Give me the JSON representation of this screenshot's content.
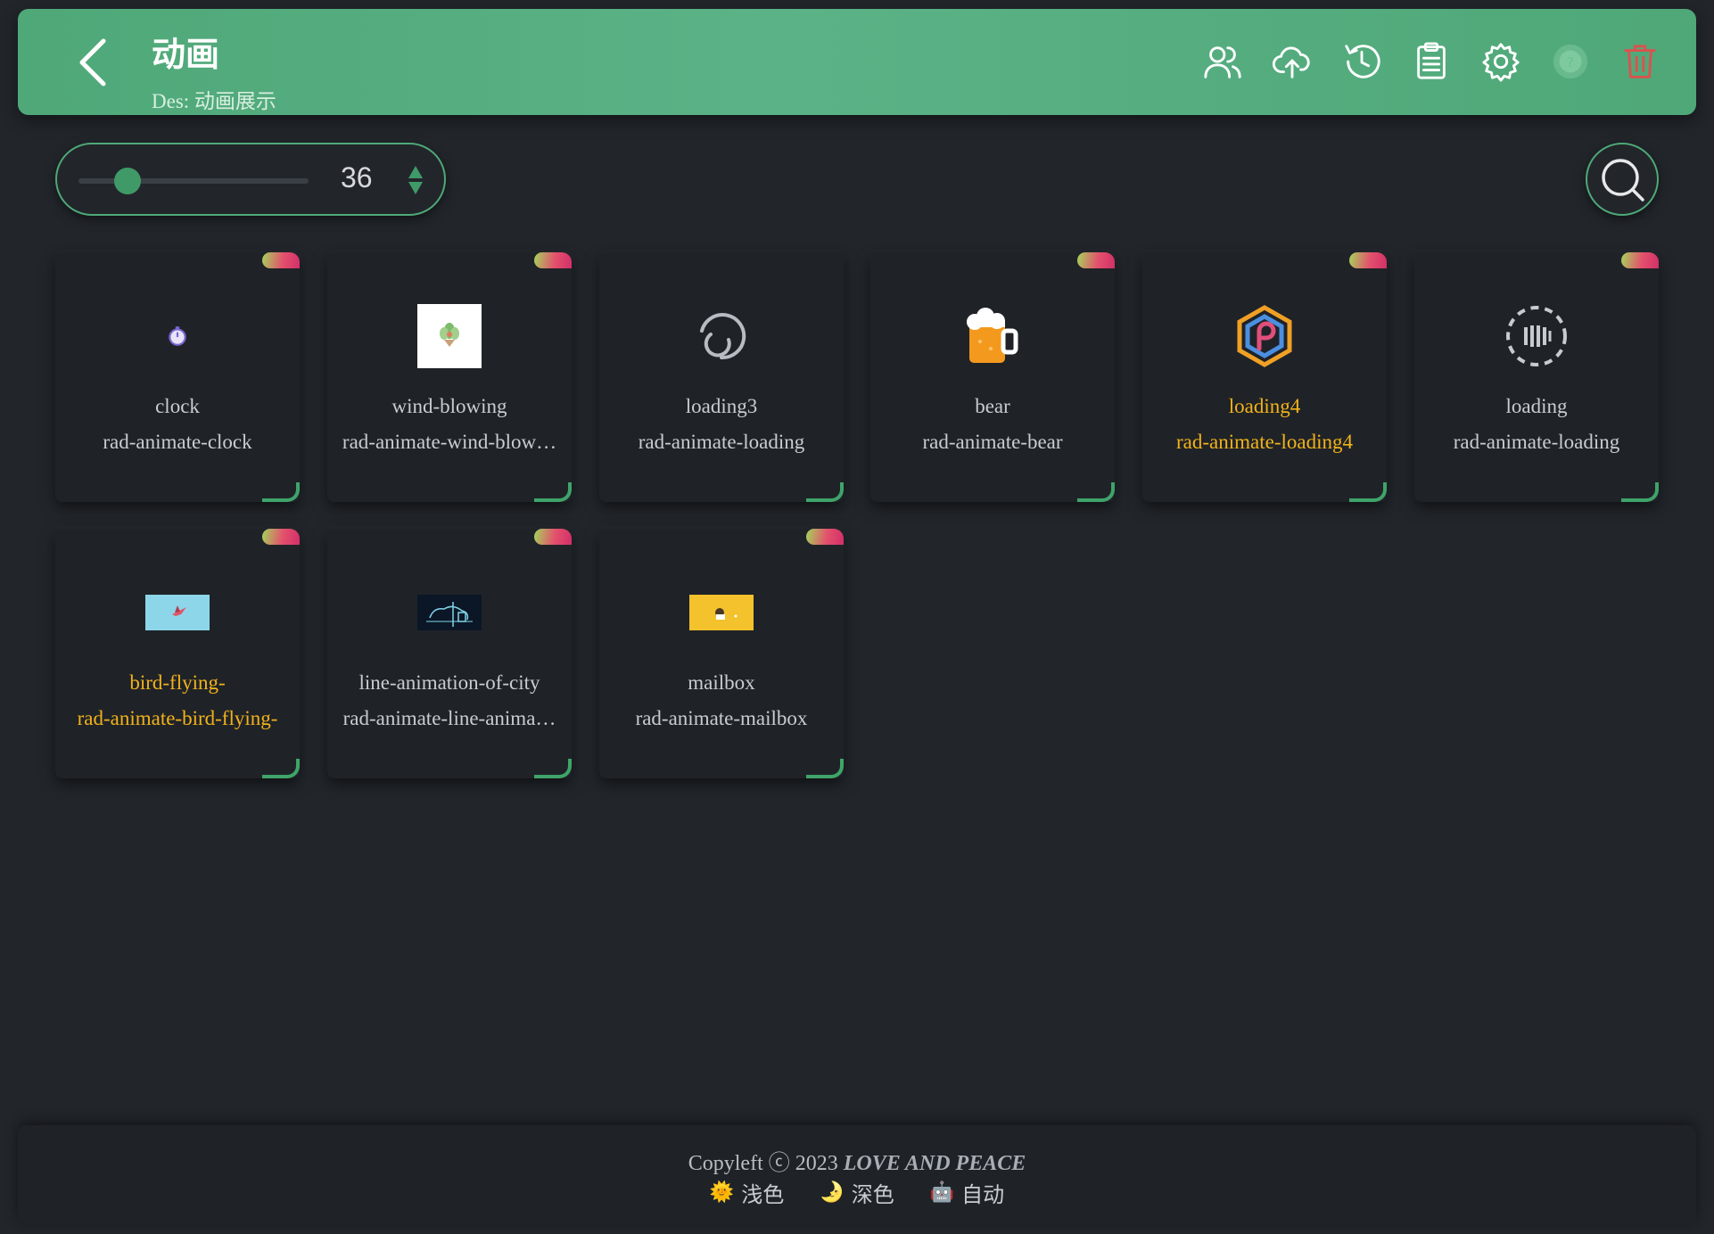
{
  "header": {
    "title": "动画",
    "subtitle": "Des: 动画展示",
    "icons": [
      "users-icon",
      "cloud-upload-icon",
      "history-icon",
      "clipboard-icon",
      "settings-icon",
      "help-icon",
      "trash-icon"
    ]
  },
  "controls": {
    "size_value": "36",
    "slider_level_fraction": 0.2
  },
  "cards": [
    {
      "name": "clock",
      "cls": "rad-animate-clock",
      "highlight": false
    },
    {
      "name": "wind-blowing",
      "cls": "rad-animate-wind-blow…",
      "highlight": false
    },
    {
      "name": "loading3",
      "cls": "rad-animate-loading",
      "highlight": false
    },
    {
      "name": "bear",
      "cls": "rad-animate-bear",
      "highlight": false
    },
    {
      "name": "loading4",
      "cls": "rad-animate-loading4",
      "highlight": true
    },
    {
      "name": "loading",
      "cls": "rad-animate-loading",
      "highlight": false
    },
    {
      "name": "bird-flying-",
      "cls": "rad-animate-bird-flying-",
      "highlight": true
    },
    {
      "name": "line-animation-of-city",
      "cls": "rad-animate-line-anima…",
      "highlight": false
    },
    {
      "name": "mailbox",
      "cls": "rad-animate-mailbox",
      "highlight": false
    }
  ],
  "footer": {
    "copyright_prefix": "Copyleft ",
    "copyright_symbol": "ⓒ",
    "copyright_year": " 2023 ",
    "copyright_tagline": "LOVE AND PEACE",
    "themes": [
      {
        "emoji": "🌞",
        "label": "浅色"
      },
      {
        "emoji": "🌛",
        "label": "深色"
      },
      {
        "emoji": "🤖",
        "label": "自动"
      }
    ]
  },
  "colors": {
    "accent": "#4fa878",
    "background": "#22262b",
    "highlight_text": "#f2b21a",
    "danger": "#d9534f"
  }
}
